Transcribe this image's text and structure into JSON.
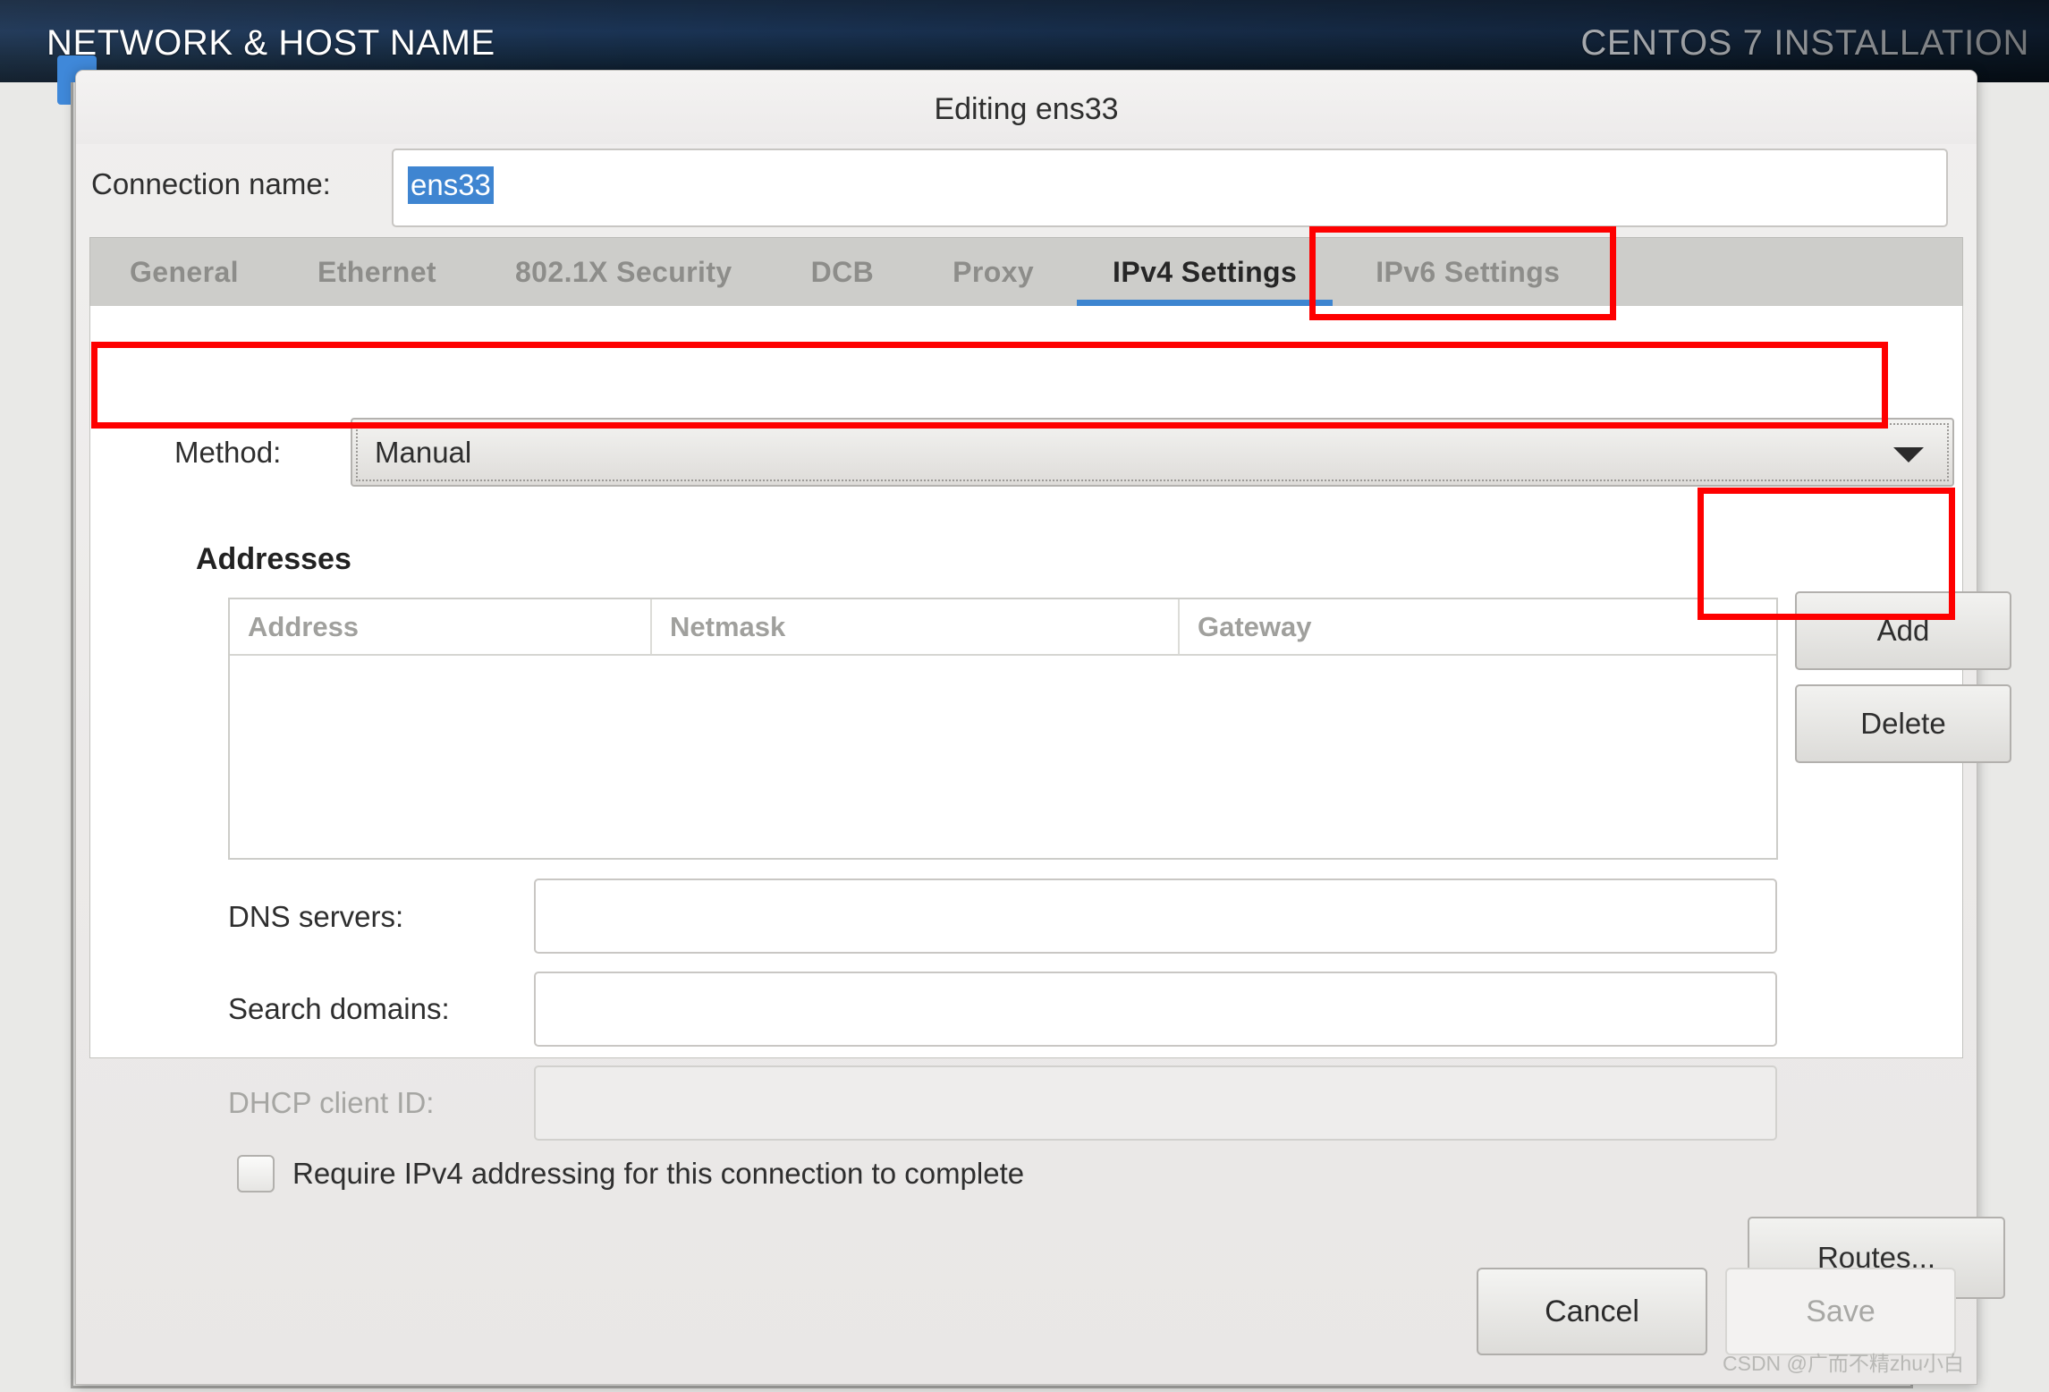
{
  "installer": {
    "page_title": "NETWORK & HOST NAME",
    "product_title": "CENTOS 7 INSTALLATION",
    "background_hostname_fragment": "H"
  },
  "dialog": {
    "title": "Editing ens33",
    "connection_name": {
      "label": "Connection name:",
      "value": "ens33",
      "selected": true
    },
    "tabs": [
      {
        "label": "General",
        "active": false
      },
      {
        "label": "Ethernet",
        "active": false
      },
      {
        "label": "802.1X Security",
        "active": false
      },
      {
        "label": "DCB",
        "active": false
      },
      {
        "label": "Proxy",
        "active": false
      },
      {
        "label": "IPv4 Settings",
        "active": true
      },
      {
        "label": "IPv6 Settings",
        "active": false
      }
    ],
    "method": {
      "label": "Method:",
      "value": "Manual",
      "arrow_icon": "chevron-down-icon",
      "focused": true
    },
    "addresses": {
      "heading": "Addresses",
      "columns": [
        "Address",
        "Netmask",
        "Gateway"
      ],
      "rows": [],
      "add_label": "Add",
      "delete_label": "Delete"
    },
    "dns": {
      "label": "DNS servers:",
      "value": "",
      "placeholder": ""
    },
    "search_domains": {
      "label": "Search domains:",
      "value": "",
      "placeholder": ""
    },
    "dhcp_client_id": {
      "label": "DHCP client ID:",
      "value": "",
      "placeholder": "",
      "disabled": true
    },
    "require_ipv4": {
      "label": "Require IPv4 addressing for this connection to complete",
      "checked": false
    },
    "routes_label": "Routes...",
    "footer": {
      "cancel_label": "Cancel",
      "save_label": "Save",
      "save_disabled": true
    }
  },
  "annotations": {
    "color": "#fe0000",
    "targets": [
      "ipv4-settings-tab",
      "method-row",
      "add-button"
    ]
  },
  "watermark": "CSDN @广而不精zhu小白"
}
